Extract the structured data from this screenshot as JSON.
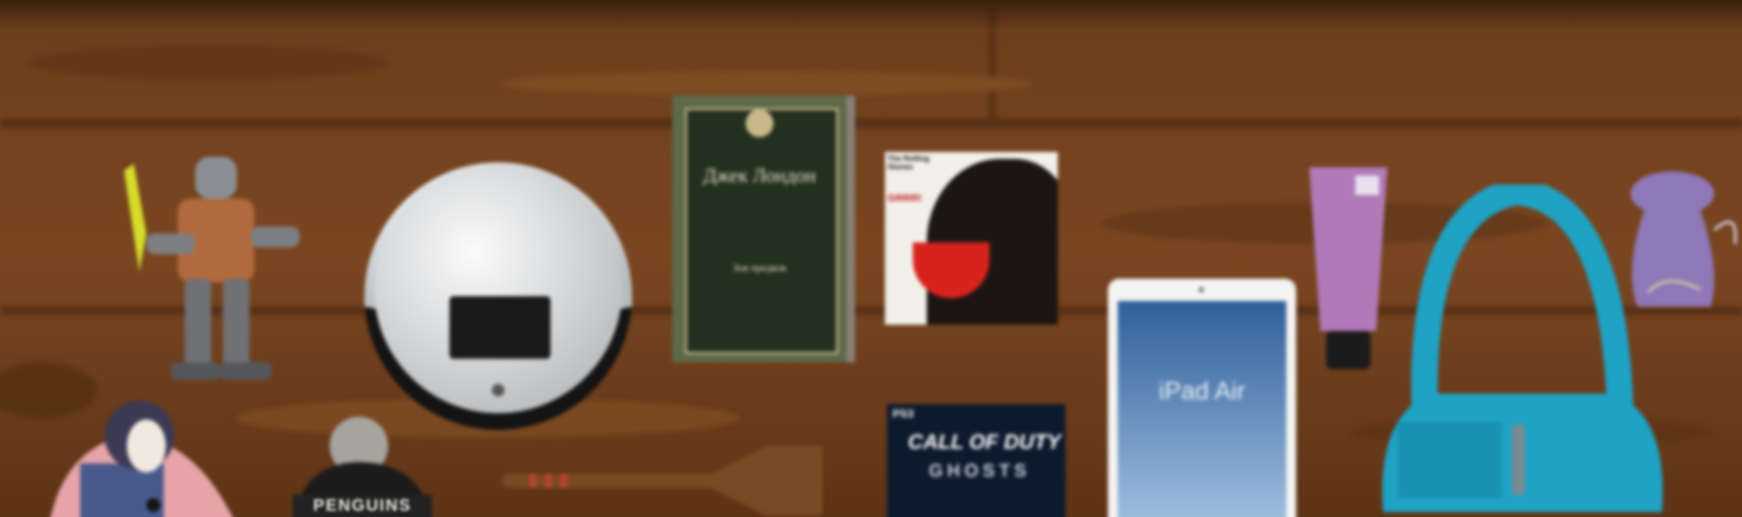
{
  "book": {
    "author": "Джек Лондон",
    "title": "Зов предков"
  },
  "album": {
    "band": "The Rolling Stones",
    "title": "GRRR!"
  },
  "game": {
    "platform": "PS3",
    "title": "CALL OF DUTY",
    "subtitle": "GHOSTS"
  },
  "tablet": {
    "screen_text": "iPad Air"
  },
  "hat": {
    "text": "PENGUINS"
  },
  "colors": {
    "wood": "#6b3d1c",
    "bag": "#1fa3c4",
    "tube": "#b07ab8",
    "pouch": "#8f78b8"
  },
  "icons": [
    "toy-robot-figure",
    "robot-vacuum",
    "book",
    "music-album-cover",
    "tablet",
    "lotion-tube",
    "handbag",
    "lavender-pouch",
    "stuffed-toy",
    "knit-hat",
    "wooden-spatula",
    "game-box"
  ]
}
